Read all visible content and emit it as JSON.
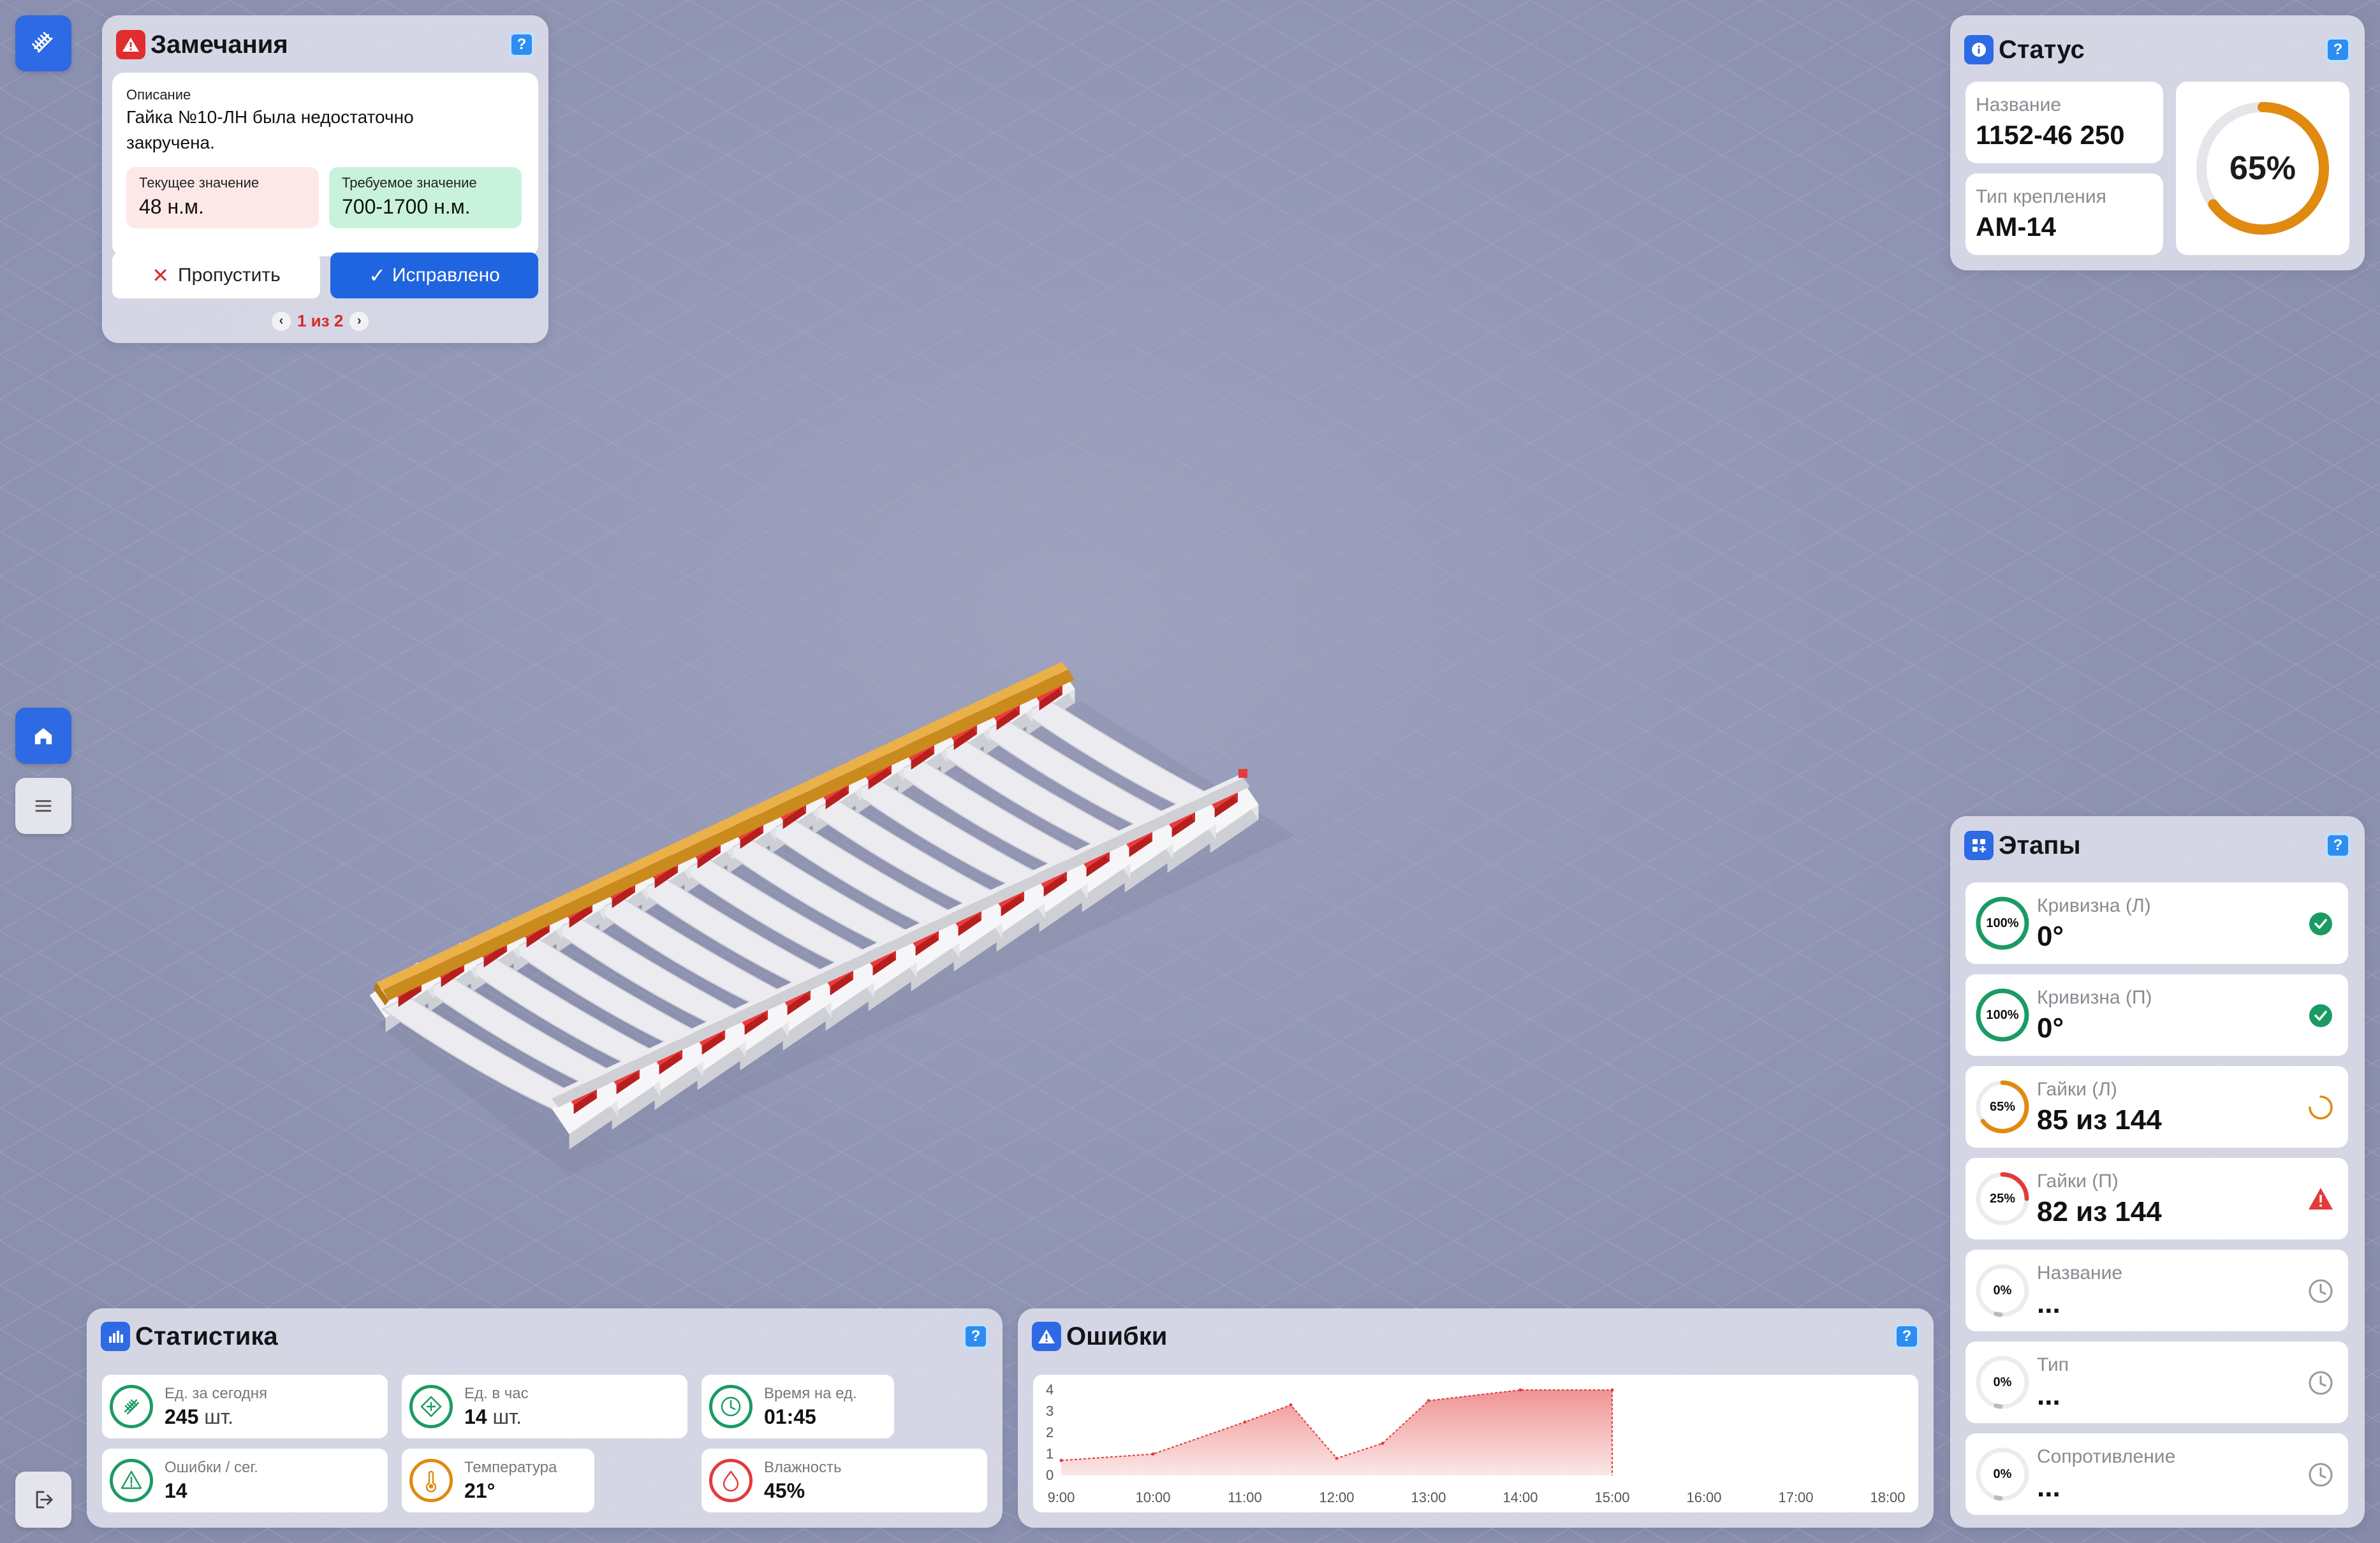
{
  "app": {
    "logo_icon": "track-icon",
    "accent": "#2d6ae3"
  },
  "side_nav": {
    "items": [
      {
        "icon": "home-icon",
        "active": true
      },
      {
        "icon": "menu-icon",
        "active": false
      }
    ],
    "logout_icon": "logout-icon"
  },
  "remarks": {
    "title": "Замечания",
    "description_label": "Описание",
    "description": "Гайка №10-ЛН была недостаточно закручена.",
    "current_label": "Текущее значение",
    "current_value": "48 н.м.",
    "required_label": "Требуемое значение",
    "required_value": "700-1700 н.м.",
    "skip_label": "Пропустить",
    "fixed_label": "Исправлено",
    "pager_text": "1 из 2"
  },
  "status": {
    "title": "Статус",
    "name_label": "Название",
    "name_value": "1152-46 250",
    "fastening_label": "Тип крепления",
    "fastening_value": "АМ-14",
    "progress_text": "65%",
    "progress": 0.65,
    "progress_color": "#e08a0f"
  },
  "stages": {
    "title": "Этапы",
    "items": [
      {
        "percent": "100%",
        "fraction": 1.0,
        "color": "#1a9b63",
        "label": "Кривизна (Л)",
        "value": "0°",
        "status": "done"
      },
      {
        "percent": "100%",
        "fraction": 1.0,
        "color": "#1a9b63",
        "label": "Кривизна (П)",
        "value": "0°",
        "status": "done"
      },
      {
        "percent": "65%",
        "fraction": 0.65,
        "color": "#e08a0f",
        "label": "Гайки (Л)",
        "value": "85 из 144",
        "status": "in-progress"
      },
      {
        "percent": "25%",
        "fraction": 0.25,
        "color": "#e23b3b",
        "label": "Гайки (П)",
        "value": "82 из 144",
        "status": "error"
      },
      {
        "percent": "0%",
        "fraction": 0,
        "color": "#bbbbbb",
        "label": "Название",
        "value": "...",
        "status": "pending"
      },
      {
        "percent": "0%",
        "fraction": 0,
        "color": "#bbbbbb",
        "label": "Тип",
        "value": "...",
        "status": "pending"
      },
      {
        "percent": "0%",
        "fraction": 0,
        "color": "#bbbbbb",
        "label": "Сопротивление",
        "value": "...",
        "status": "pending"
      }
    ]
  },
  "stats": {
    "title": "Статистика",
    "items": [
      {
        "label": "Ед. за сегодня",
        "value": "245",
        "unit": "шт.",
        "icon": "track-icon",
        "color": "#1a9b63"
      },
      {
        "label": "Ед. в час",
        "value": "14",
        "unit": "шт.",
        "icon": "crosshair-icon",
        "color": "#1a9b63"
      },
      {
        "label": "Время на ед.",
        "value": "01:45",
        "unit": "",
        "icon": "clock-icon",
        "color": "#1a9b63"
      },
      {
        "label": "Ошибки / сег.",
        "value": "14",
        "unit": "",
        "icon": "warning-icon",
        "color": "#1a9b63"
      },
      {
        "label": "Температура",
        "value": "21°",
        "unit": "",
        "icon": "thermometer-icon",
        "color": "#e08a0f"
      },
      {
        "label": "Влажность",
        "value": "45%",
        "unit": "",
        "icon": "drop-icon",
        "color": "#e23b3b"
      }
    ]
  },
  "errors": {
    "title": "Ошибки",
    "chart_data": {
      "type": "area",
      "x": [
        "9:00",
        "10:00",
        "11:00",
        "11:30",
        "12:00",
        "12:30",
        "13:00",
        "14:00",
        "15:00"
      ],
      "x_ticks": [
        "9:00",
        "10:00",
        "11:00",
        "12:00",
        "13:00",
        "14:00",
        "15:00",
        "16:00",
        "17:00",
        "18:00"
      ],
      "values": [
        0.7,
        1.0,
        2.5,
        3.3,
        0.8,
        1.5,
        3.5,
        4.0,
        4.0
      ],
      "y_ticks": [
        "0",
        "1",
        "2",
        "3",
        "4"
      ],
      "ylim": [
        0,
        4
      ],
      "color": "#e23b3b"
    }
  }
}
